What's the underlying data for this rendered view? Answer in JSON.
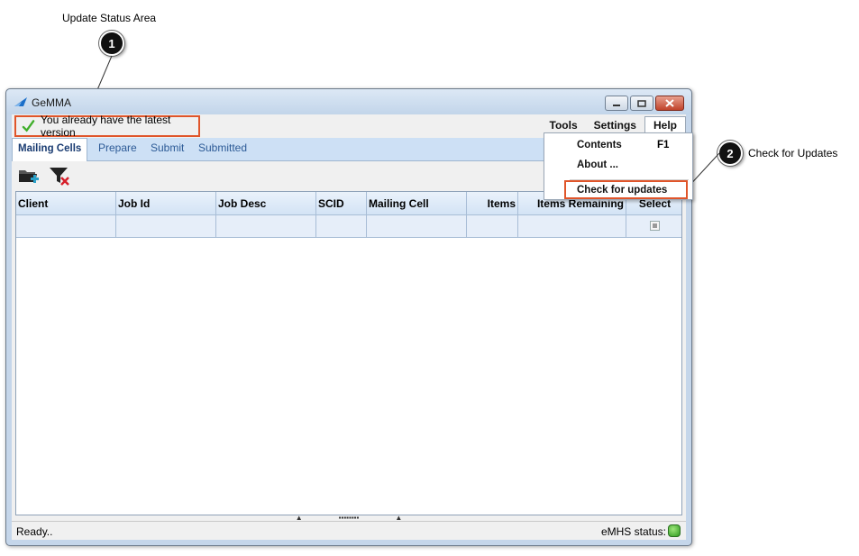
{
  "callouts": [
    {
      "number": "1",
      "label": "Update Status Area"
    },
    {
      "number": "2",
      "label": "Check for Updates"
    }
  ],
  "window": {
    "title": "GeMMA"
  },
  "update_status": {
    "text": "You already have the latest version",
    "icon": "checkmark-icon"
  },
  "menubar": {
    "items": [
      "Tools",
      "Settings",
      "Help"
    ],
    "open": "Help"
  },
  "help_menu": {
    "items": [
      {
        "label": "Contents",
        "shortcut": "F1"
      },
      {
        "label": "About ...",
        "shortcut": ""
      },
      {
        "label": "Check for updates",
        "shortcut": ""
      }
    ]
  },
  "tabs": [
    "Mailing Cells",
    "Prepare",
    "Submit",
    "Submitted"
  ],
  "active_tab": "Mailing Cells",
  "toolbar": {
    "icons": [
      "add-folder-icon",
      "clear-filter-icon"
    ]
  },
  "grid": {
    "columns": [
      "Client",
      "Job Id",
      "Job Desc",
      "SCID",
      "Mailing Cell",
      "Items",
      "Items Remaining",
      "Select"
    ]
  },
  "statusbar": {
    "left": "Ready..",
    "right": "eMHS status:"
  },
  "colors": {
    "highlight": "#e0552a",
    "tab_bg": "#cde0f5",
    "status_ok": "#3fae2a"
  }
}
